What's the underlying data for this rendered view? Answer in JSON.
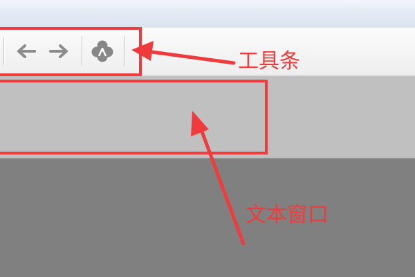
{
  "annotations": {
    "toolbar_label": "工具条",
    "text_window_label": "文本窗口"
  },
  "colors": {
    "annotation_red": "#ef3b3b",
    "toolbar_bg": "#f2f2f2",
    "text_window_bg": "#c0c0c0",
    "workspace_bg": "#808080"
  },
  "toolbar": {
    "buttons": [
      {
        "icon": "arrow-left-icon"
      },
      {
        "icon": "arrow-right-icon"
      },
      {
        "icon": "clover-icon"
      }
    ]
  }
}
